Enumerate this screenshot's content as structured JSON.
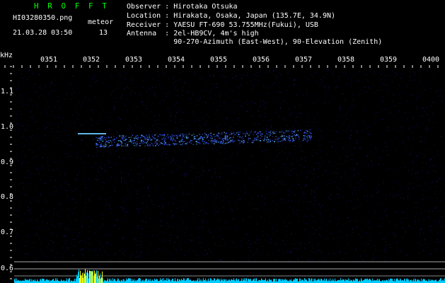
{
  "app": {
    "name": "H R O F F T",
    "file": "HI03280350.png",
    "datetime": "21.03.28 03:50",
    "meteor_label": "meteor",
    "meteor_count": "13"
  },
  "info": {
    "observer": "Observer : Hirotaka Otsuka",
    "location": "Location : Hirakata, Osaka, Japan (135.7E, 34.9N)",
    "receiver": "Receiver : YAESU FT-690 53.755MHz(Fukui), USB",
    "antenna": "Antenna  : 2el-HB9CV, 4m's high",
    "antenna2": "           90-270-Azimuth (East-West), 90-Elevation (Zenith)"
  },
  "axis": {
    "unit": "kHz",
    "time_ticks": [
      "0351",
      "0352",
      "0353",
      "0354",
      "0355",
      "0356",
      "0357",
      "0358",
      "0359",
      "0400"
    ],
    "freq_ticks": [
      "1.1",
      "1.0",
      "0.9",
      "0.8",
      "0.7",
      "0.6"
    ]
  },
  "colors": {
    "background": "#000000",
    "header_green": "#00ff00",
    "text_white": "#ffffff",
    "noise_blue": "#1a1a8c",
    "signal_blue": "#3355ff",
    "signal_cyan": "#66ccff",
    "bottom_cyan": "#00ccff",
    "bottom_yellow": "#ffff00"
  }
}
